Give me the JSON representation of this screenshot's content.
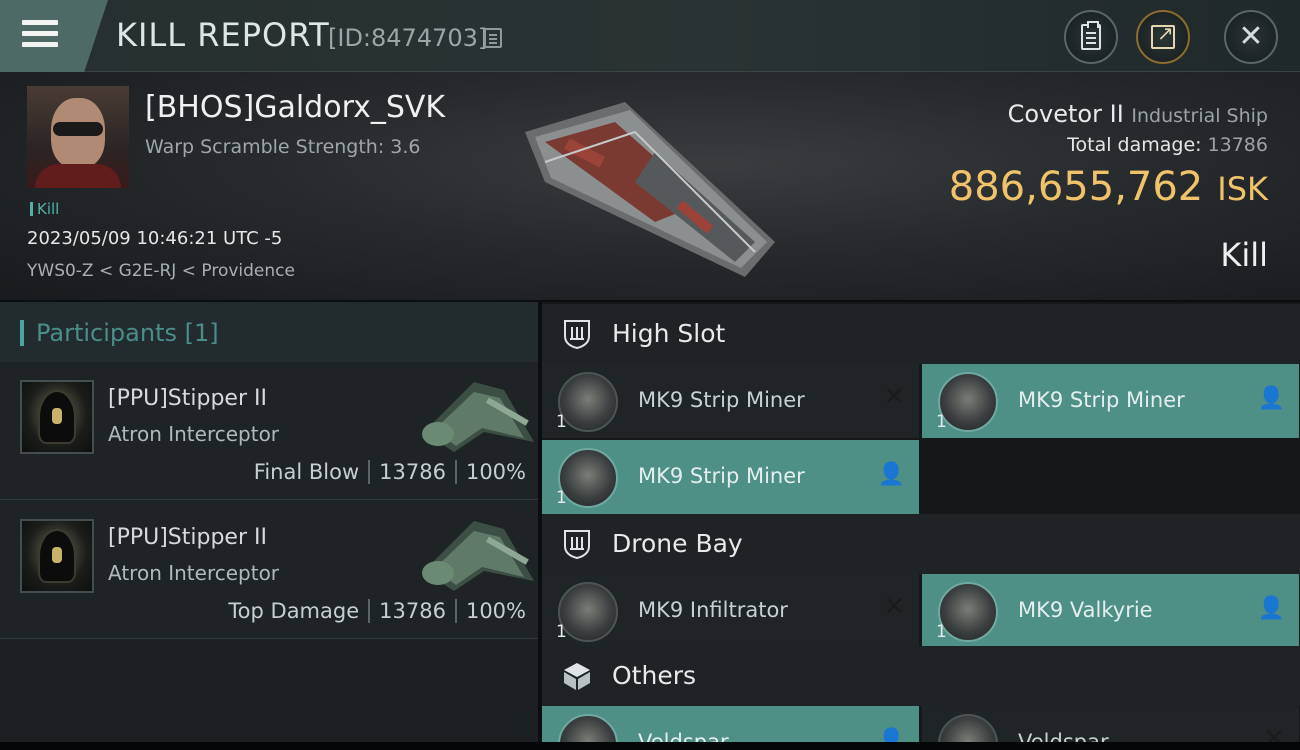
{
  "header": {
    "title": "KILL REPORT",
    "report_id": "[ID:8474703]"
  },
  "victim": {
    "pilot_name": "[BHOS]Galdorx_SVK",
    "warp_scramble": "Warp Scramble Strength: 3.6",
    "kill_tag": "Kill",
    "datetime": "2023/05/09 10:46:21 UTC -5",
    "location": "YWS0-Z < G2E-RJ < Providence",
    "ship_name": "Covetor II",
    "ship_class": "Industrial Ship",
    "total_damage_label": "Total damage:",
    "total_damage": "13786",
    "isk_value": "886,655,762",
    "isk_unit": "ISK",
    "result": "Kill"
  },
  "participants": {
    "label": "Participants [1]",
    "rows": [
      {
        "name": "[PPU]Stipper II",
        "ship": "Atron Interceptor",
        "role": "Final Blow",
        "damage": "13786",
        "percent": "100%"
      },
      {
        "name": "[PPU]Stipper II",
        "ship": "Atron Interceptor",
        "role": "Top Damage",
        "damage": "13786",
        "percent": "100%"
      }
    ]
  },
  "fitting": {
    "sections": [
      {
        "title": "High Slot",
        "icon": "high-slot-icon",
        "items": [
          {
            "name": "MK9 Strip Miner",
            "qty": "1",
            "status": "destroyed"
          },
          {
            "name": "MK9 Strip Miner",
            "qty": "1",
            "status": "dropped"
          },
          {
            "name": "MK9 Strip Miner",
            "qty": "1",
            "status": "dropped"
          }
        ]
      },
      {
        "title": "Drone Bay",
        "icon": "drone-bay-icon",
        "items": [
          {
            "name": "MK9  Infiltrator",
            "qty": "1",
            "status": "destroyed"
          },
          {
            "name": "MK9  Valkyrie",
            "qty": "1",
            "status": "dropped"
          }
        ]
      },
      {
        "title": "Others",
        "icon": "cargo-box-icon",
        "items": [
          {
            "name": "Veldspar",
            "qty": "",
            "status": "dropped"
          },
          {
            "name": "Veldspar",
            "qty": "",
            "status": "destroyed"
          }
        ]
      }
    ]
  },
  "colors": {
    "accent_teal": "#4e9086",
    "isk_gold": "#f0c36b",
    "menu_button": "#4e6a66"
  }
}
